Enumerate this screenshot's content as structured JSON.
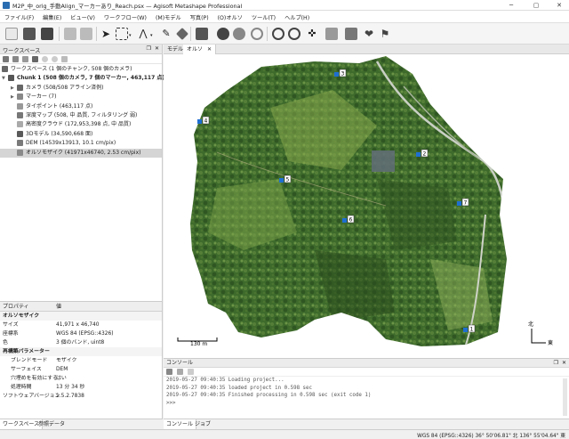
{
  "window": {
    "title": "M2P_中_orig_手動Align_マーカーあり_Reach.psx — Agisoft Metashape Professional",
    "controls": [
      "─",
      "▢",
      "✕"
    ]
  },
  "menu": [
    "ファイル(F)",
    "編集(E)",
    "ビュー(V)",
    "ワークフロー(W)",
    "(M)モデル",
    "写真(P)",
    "(O)オルソ",
    "ツール(T)",
    "ヘルプ(H)"
  ],
  "workspace": {
    "title": "ワークスペース",
    "root": "ワークスペース (1 個のチャンク, 508 個のカメラ)",
    "chunk": "Chunk 1 (508 個のカメラ, 7 個のマーカー, 463,117 点) [R]",
    "items": [
      {
        "label": "カメラ (508/508 アライン済例)",
        "icon": "camera-folder-icon",
        "expandable": true
      },
      {
        "label": "マーカー (7)",
        "icon": "marker-folder-icon",
        "expandable": true
      },
      {
        "label": "タイポイント (463,117 点)",
        "icon": "tie-points-icon",
        "expandable": false
      },
      {
        "label": "深度マップ (508, 中 品質, フィルタリング 弱)",
        "icon": "depth-maps-icon",
        "expandable": false
      },
      {
        "label": "高密度クラウド (172,953,398 点, 中 品質)",
        "icon": "dense-cloud-icon",
        "expandable": false
      },
      {
        "label": "3Dモデル (34,590,668 面)",
        "icon": "mesh-model-icon",
        "expandable": false
      },
      {
        "label": "DEM (14539x13913, 10.1 cm/pix)",
        "icon": "dem-icon",
        "expandable": false
      },
      {
        "label": "オルソモザイク (41971x46740, 2.53 cm/pix)",
        "icon": "orthomosaic-icon",
        "expandable": false
      }
    ]
  },
  "properties": {
    "col_property": "プロパティ",
    "col_value": "値",
    "rows": [
      {
        "k": "オルソモザイク",
        "v": "",
        "type": "grp"
      },
      {
        "k": "サイズ",
        "v": "41,971 x 46,740",
        "type": "row"
      },
      {
        "k": "座標系",
        "v": "WGS 84 (EPSG::4326)",
        "type": "row"
      },
      {
        "k": "色",
        "v": "3 個のバンド, uint8",
        "type": "row"
      },
      {
        "k": "再構築パラメーター",
        "v": "",
        "type": "grp"
      },
      {
        "k": "ブレンドモード",
        "v": "モザイク",
        "type": "sub"
      },
      {
        "k": "サーフェイス",
        "v": "DEM",
        "type": "sub"
      },
      {
        "k": "穴埋めを有効にする",
        "v": "はい",
        "type": "sub"
      },
      {
        "k": "処理時間",
        "v": "13 分 34 秒",
        "type": "sub"
      },
      {
        "k": "ソフトウェアバージョン",
        "v": "1.5.2.7838",
        "type": "row"
      }
    ]
  },
  "left_tabs": [
    "ワークスペース",
    "参照データ"
  ],
  "view_tabs": [
    "モデル",
    "オルソ"
  ],
  "ortho": {
    "scale_label": "130 m",
    "north_label": "北",
    "east_label": "東",
    "markers": [
      {
        "id": "1"
      },
      {
        "id": "2"
      },
      {
        "id": "3"
      },
      {
        "id": "4"
      },
      {
        "id": "5"
      },
      {
        "id": "6"
      },
      {
        "id": "7"
      }
    ]
  },
  "console": {
    "title": "コンソール",
    "lines": [
      "2019-05-27 09:40:35 Loading project...",
      "2019-05-27 09:40:35 loaded project in 0.598 sec",
      "2019-05-27 09:40:35 Finished processing in 0.598 sec (exit code 1)",
      ">>>"
    ]
  },
  "console_tabs": [
    "コンソール",
    "ジョブ"
  ],
  "status": "WGS 84 (EPSG::4326)   36° 50'06.81\" 北   136° 55'04.64\" 東"
}
